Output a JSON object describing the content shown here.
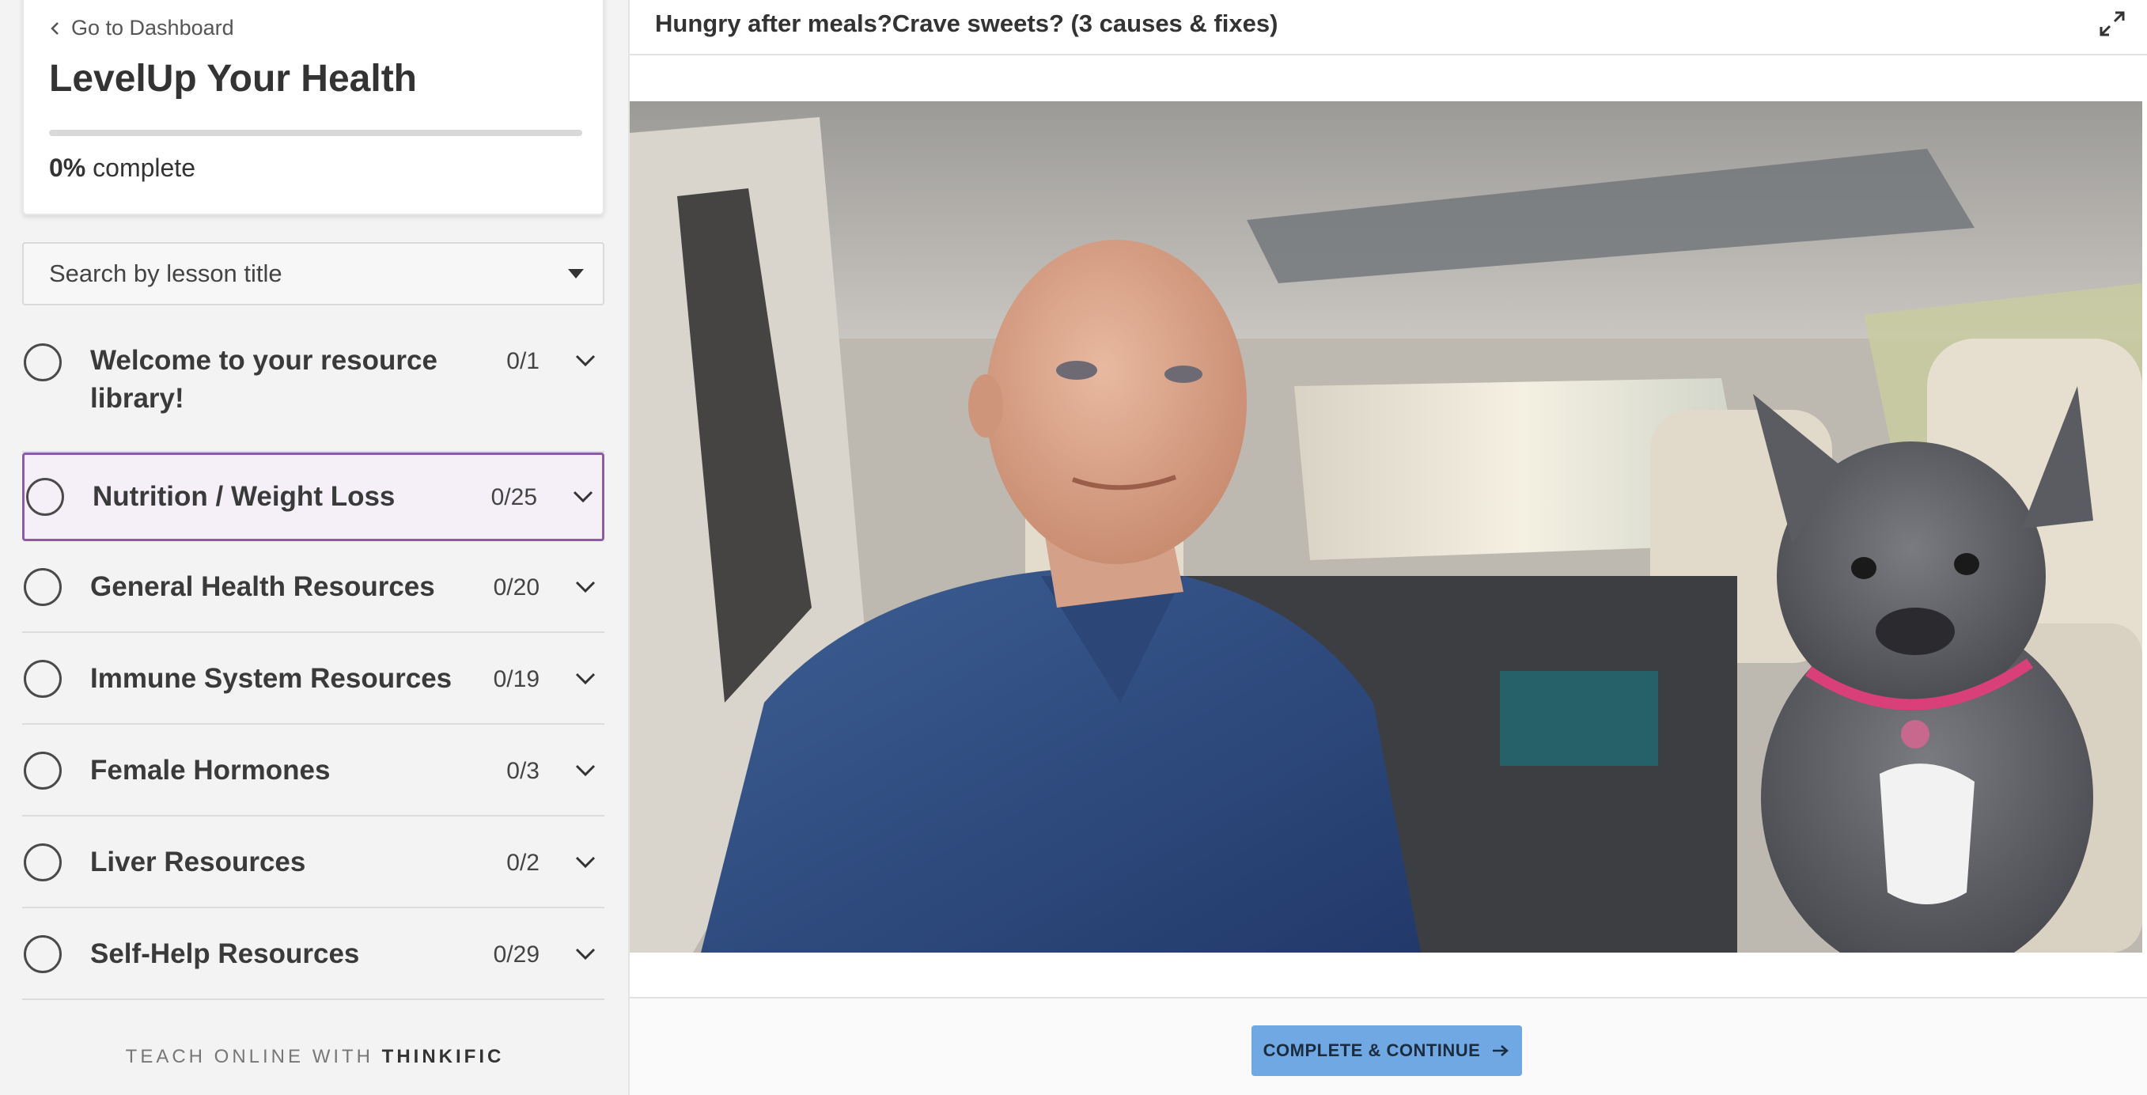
{
  "sidebar": {
    "back_label": "Go to Dashboard",
    "course_title": "LevelUp Your Health",
    "progress": {
      "percent": 0,
      "percent_label": "0%",
      "suffix": " complete"
    },
    "search_placeholder": "Search by lesson title",
    "chapters": [
      {
        "title": "Welcome to your resource library!",
        "count": "0/1",
        "active": false
      },
      {
        "title": "Nutrition / Weight Loss",
        "count": "0/25",
        "active": true
      },
      {
        "title": "General Health Resources",
        "count": "0/20",
        "active": false
      },
      {
        "title": "Immune System Resources",
        "count": "0/19",
        "active": false
      },
      {
        "title": "Female Hormones",
        "count": "0/3",
        "active": false
      },
      {
        "title": "Liver Resources",
        "count": "0/2",
        "active": false
      },
      {
        "title": "Self-Help Resources",
        "count": "0/29",
        "active": false
      }
    ],
    "footer": {
      "prefix": "TEACH ONLINE WITH ",
      "brand": "THINKIFIC"
    }
  },
  "main": {
    "lesson_title": "Hungry after meals?Crave sweets? (3 causes & fixes)",
    "complete_button_label": "COMPLETE & CONTINUE"
  },
  "colors": {
    "accent_purple": "#8d5aa8",
    "button_blue": "#6fa8e3"
  },
  "icons": {
    "back": "chevron-left-icon",
    "dropdown": "caret-down-icon",
    "chapter_status": "circle-outline-icon",
    "chapter_expand": "chevron-down-icon",
    "fullscreen": "expand-icon",
    "continue": "arrow-right-icon"
  }
}
